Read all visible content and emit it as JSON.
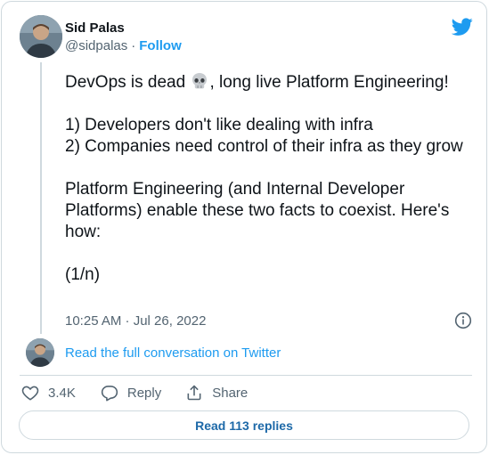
{
  "author": {
    "name": "Sid Palas",
    "handle": "@sidpalas",
    "separator": "·",
    "follow_label": "Follow"
  },
  "tweet": {
    "line1_before_emoji": "DevOps is dead ",
    "emoji": "skull-emoji",
    "line1_after_emoji": ", long live Platform Engineering!",
    "body": "\n\n1) Developers don't like dealing with infra\n2) Companies need control of their infra as they grow\n\nPlatform Engineering (and Internal Developer Platforms) enable these two facts to coexist. Here's how:\n\n(1/n)",
    "timestamp": "10:25 AM · Jul 26, 2022"
  },
  "conversation": {
    "read_label": "Read the full conversation on Twitter"
  },
  "actions": {
    "like_count": "3.4K",
    "reply_label": "Reply",
    "share_label": "Share"
  },
  "replies": {
    "read_label": "Read 113 replies"
  },
  "icons": {
    "brand": "twitter-bird-icon",
    "info": "info-icon",
    "like": "heart-icon",
    "reply": "speech-bubble-icon",
    "share": "share-icon"
  },
  "colors": {
    "accent": "#1d9bf0",
    "text": "#0f1419",
    "secondary": "#536471",
    "border": "#cfd9de"
  }
}
